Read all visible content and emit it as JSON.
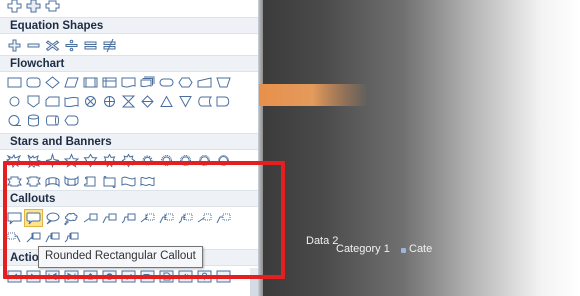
{
  "sections": {
    "equation": "Equation Shapes",
    "flowchart": "Flowchart",
    "stars": "Stars and Banners",
    "callouts": "Callouts",
    "action": "Actio"
  },
  "tooltip": "Rounded Rectangular Callout",
  "chart_labels": {
    "series": "Data 2",
    "category": "Category 1",
    "partial": "Cate"
  },
  "icons": {
    "top_row": [
      "plus-shape",
      "cross-shape",
      "cross-outline-shape"
    ],
    "equation": [
      "plus-equation",
      "minus-equation",
      "multiply-equation",
      "division-equation",
      "equal-equation",
      "not-equal-equation"
    ],
    "flowchart_row1": [
      "process",
      "alternate-process",
      "decision",
      "predefined-process",
      "internal-storage",
      "document",
      "multidocument",
      "terminator",
      "preparation",
      "manual-input",
      "manual-operation"
    ],
    "flowchart_row2": [
      "connector",
      "off-page-connector",
      "card",
      "punched-tape",
      "summing-junction",
      "or",
      "collate",
      "sort",
      "extract",
      "merge",
      "stored-data",
      "delay"
    ],
    "flowchart_row3": [
      "sequential-access-storage",
      "magnetic-disk",
      "direct-access-storage",
      "display"
    ],
    "stars_row1": [
      "explosion-1",
      "explosion-2",
      "4-point-star",
      "5-point-star",
      "6-point-star",
      "7-point-star",
      "8-point-star",
      "10-point-star",
      "12-point-star",
      "16-point-star",
      "24-point-star",
      "32-point-star"
    ],
    "stars_row2": [
      "up-ribbon",
      "down-ribbon",
      "curved-up-ribbon",
      "curved-down-ribbon",
      "vertical-scroll",
      "horizontal-scroll",
      "wave",
      "double-wave"
    ],
    "callouts_row1": [
      "rectangular-callout",
      "rounded-rectangular-callout",
      "oval-callout",
      "cloud-callout",
      "line-callout-1",
      "line-callout-2",
      "line-callout-3",
      "line-callout-1-accent",
      "line-callout-2-accent",
      "line-callout-3-accent",
      "line-callout-1-no-border",
      "line-callout-2-no-border"
    ],
    "callouts_row2": [
      "line-callout-3-no-border",
      "line-callout-1-border-accent",
      "line-callout-2-border-accent",
      "line-callout-3-border-accent"
    ],
    "action_row": [
      "action-back",
      "action-forward",
      "action-beginning",
      "action-end",
      "action-home",
      "action-information",
      "action-return",
      "action-movie",
      "action-document",
      "action-sound",
      "action-help",
      "action-blank"
    ]
  },
  "colors": {
    "annotation": "#e51f1f",
    "highlight": "#fde58c",
    "chart_orange": "#e8904a"
  }
}
